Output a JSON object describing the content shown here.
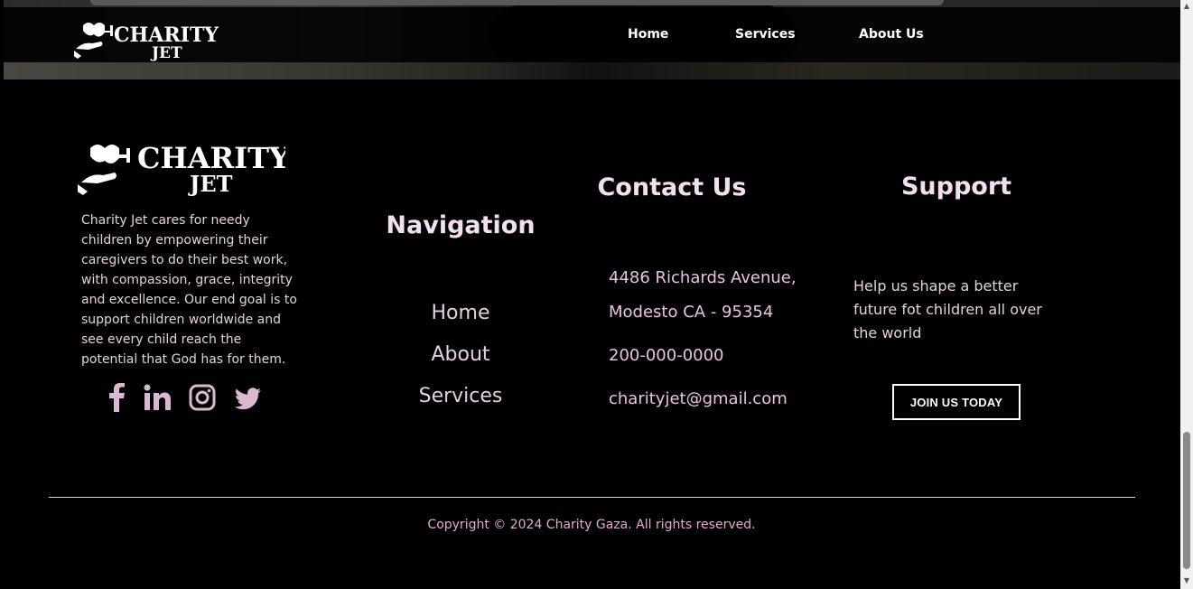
{
  "brand": {
    "name_line1": "CHARITY",
    "name_line2": "JET",
    "colors": {
      "background": "#000000",
      "heading": "#f3dff0",
      "text": "#e6cfe0",
      "accent_pink": "#ebc1e6"
    }
  },
  "header": {
    "nav": [
      {
        "label": "Home"
      },
      {
        "label": "Services"
      },
      {
        "label": "About Us"
      }
    ]
  },
  "footer": {
    "about_text": "Charity Jet cares for needy children by empowering their caregivers to do their best work, with compassion, grace, integrity and excellence. Our end goal is to support children worldwide and see every child reach the potential that God has for them.",
    "social_icons": [
      "facebook-icon",
      "linkedin-icon",
      "instagram-icon",
      "twitter-icon"
    ],
    "navigation": {
      "title": "Navigation",
      "links": [
        {
          "label": "Home"
        },
        {
          "label": "About"
        },
        {
          "label": "Services"
        }
      ]
    },
    "contact": {
      "title": "Contact Us",
      "address_line1": "4486 Richards Avenue,",
      "address_line2": "Modesto CA - 95354",
      "phone": "200-000-0000",
      "email": "charityjet@gmail.com"
    },
    "support": {
      "title": "Support",
      "text": "Help us shape a better future fot children all over the world",
      "button_label": "JOIN US TODAY"
    },
    "copyright": "Copyright © 2024 Charity Gaza. All rights reserved."
  }
}
